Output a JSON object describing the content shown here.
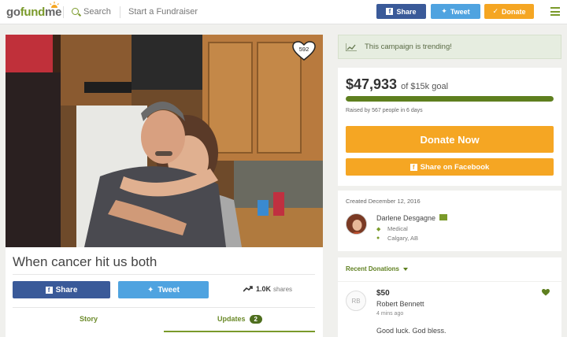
{
  "header": {
    "logo_go": "go",
    "logo_fund": "fund",
    "logo_me": "me",
    "search_label": "Search",
    "start_label": "Start a Fundraiser",
    "share_label": "Share",
    "tweet_label": "Tweet",
    "donate_label": "Donate"
  },
  "campaign": {
    "title": "When cancer hit us both",
    "heart_count": "592",
    "share_label": "Share",
    "tweet_label": "Tweet",
    "shares_count": "1.0K",
    "shares_label": "shares",
    "tabs": [
      {
        "label": "Story"
      },
      {
        "label": "Updates",
        "count": "2"
      }
    ]
  },
  "sidebar": {
    "trending_text": "This campaign is trending!",
    "raised_amount": "$47,933",
    "goal_text": "of $15k goal",
    "progress_percent": 100,
    "raised_by": "Raised by 567 people in 6 days",
    "donate_now_label": "Donate Now",
    "share_facebook_label": "Share on Facebook",
    "created": "Created December 12, 2016",
    "organizer_name": "Darlene Desgagne",
    "category": "Medical",
    "location": "Calgary, AB",
    "recent_donations_label": "Recent Donations",
    "donation": {
      "initials": "RB",
      "amount": "$50",
      "name": "Robert Bennett",
      "time": "4 mins ago",
      "message": "Good luck. God bless."
    }
  },
  "colors": {
    "brand_green": "#7a9a2a",
    "facebook_blue": "#3a5a99",
    "twitter_blue": "#4fa3e0",
    "donate_orange": "#f5a623"
  }
}
